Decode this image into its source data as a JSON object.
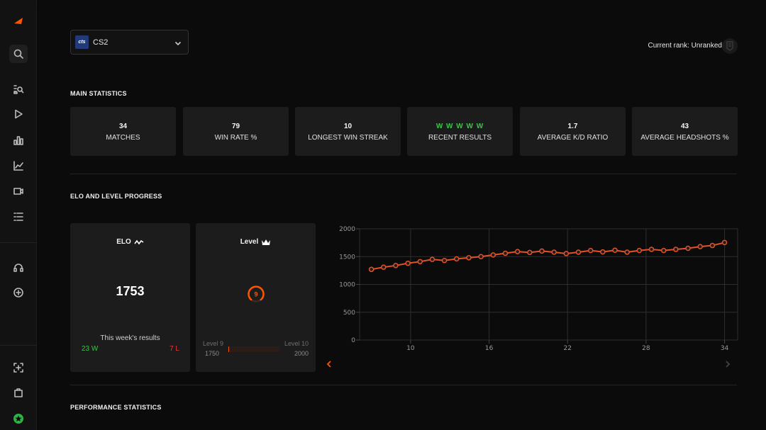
{
  "sidebar": {
    "icons": [
      "logo-icon",
      "search-icon",
      "player-search-icon",
      "play-icon",
      "bar-chart-icon",
      "line-chart-icon",
      "video-icon",
      "list-icon",
      "support-icon",
      "add-icon",
      "screenshot-icon",
      "bag-icon",
      "star-badge-icon"
    ]
  },
  "header": {
    "game": {
      "logo_text": "cts",
      "name": "CS2"
    },
    "rank_text": "Current rank: Unranked"
  },
  "main_statistics": {
    "title": "MAIN STATISTICS",
    "cards": [
      {
        "value": "34",
        "label": "MATCHES"
      },
      {
        "value": "79",
        "label": "WIN RATE %"
      },
      {
        "value": "10",
        "label": "LONGEST WIN STREAK"
      },
      {
        "value": "W W W W W",
        "label": "RECENT RESULTS"
      },
      {
        "value": "1.7",
        "label": "AVERAGE K/D RATIO"
      },
      {
        "value": "43",
        "label": "AVERAGE HEADSHOTS %"
      }
    ]
  },
  "elo_section": {
    "title": "ELO AND LEVEL PROGRESS",
    "elo": {
      "title": "ELO",
      "value": "1753",
      "week_label": "This week's results",
      "wins": "23 W",
      "losses": "7 L"
    },
    "level": {
      "title": "Level",
      "value": "9",
      "current_label": "Level 9",
      "current_elo": "1750",
      "next_label": "Level 10",
      "next_elo": "2000",
      "progress_fraction": 0.012
    }
  },
  "performance": {
    "title": "PERFORMANCE STATISTICS"
  },
  "colors": {
    "accent": "#ff5500",
    "line": "#e0522a",
    "win": "#3ec24b",
    "loss": "#e53935",
    "card": "#1c1c1c"
  },
  "chart_data": {
    "type": "line",
    "x": [
      7,
      8,
      9,
      10,
      11,
      12,
      13,
      14,
      15,
      16,
      17,
      18,
      19,
      20,
      21,
      22,
      23,
      24,
      25,
      26,
      27,
      28,
      29,
      30,
      31,
      32,
      33,
      34
    ],
    "xticks": [
      10,
      16,
      22,
      28,
      34
    ],
    "yticks": [
      0,
      500,
      1000,
      1500,
      2000
    ],
    "ylim": [
      0,
      2000
    ],
    "xlim": [
      6.1,
      35
    ],
    "series": [
      {
        "values": [
          1270,
          1310,
          1340,
          1380,
          1410,
          1450,
          1430,
          1460,
          1480,
          1500,
          1530,
          1560,
          1590,
          1575,
          1600,
          1580,
          1555,
          1580,
          1610,
          1585,
          1615,
          1580,
          1610,
          1630,
          1610,
          1630,
          1650,
          1680,
          1700,
          1753
        ]
      }
    ],
    "grid": true
  }
}
